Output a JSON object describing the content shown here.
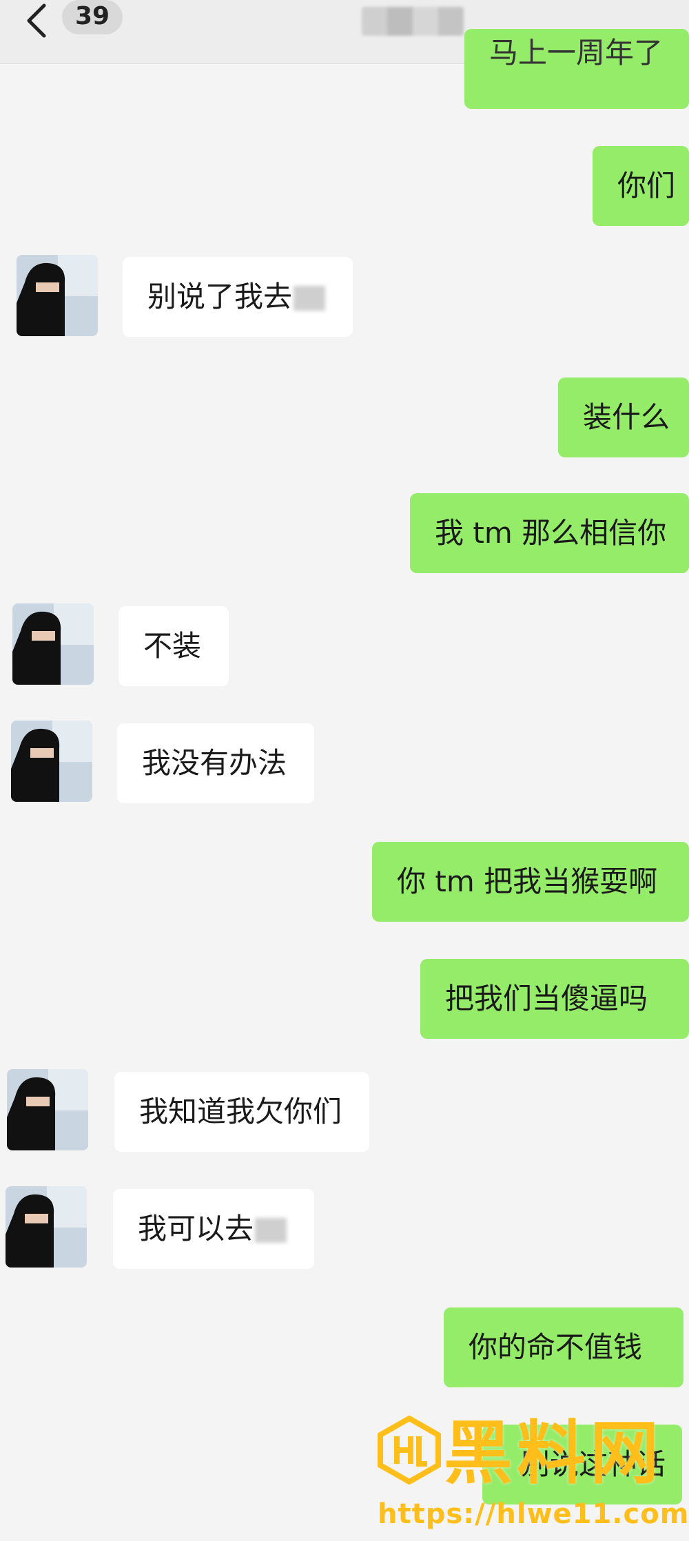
{
  "header": {
    "unread_count": "39",
    "back_icon": "chevron-left-icon"
  },
  "messages": [
    {
      "side": "out",
      "text": "马上一周年了"
    },
    {
      "side": "out",
      "text": "你们"
    },
    {
      "side": "in",
      "text": "别说了我去死"
    },
    {
      "side": "out",
      "text": "装什么"
    },
    {
      "side": "out",
      "text": "我 tm 那么相信你"
    },
    {
      "side": "in",
      "text": "不装"
    },
    {
      "side": "in",
      "text": "我没有办法"
    },
    {
      "side": "out",
      "text": "你 tm 把我当猴耍啊"
    },
    {
      "side": "out",
      "text": "把我们当傻逼吗"
    },
    {
      "side": "in",
      "text": "我知道我欠你们"
    },
    {
      "side": "in",
      "text": "我可以去死"
    },
    {
      "side": "out",
      "text": "你的命不值钱"
    },
    {
      "side": "out",
      "text": "别说这种话"
    }
  ],
  "watermark": {
    "name": "黑料网",
    "url": "https://hlwe11.com"
  },
  "colors": {
    "outgoing_bubble": "#95ec69",
    "incoming_bubble": "#ffffff",
    "background": "#f4f4f4",
    "watermark": "#ffbe1a"
  }
}
